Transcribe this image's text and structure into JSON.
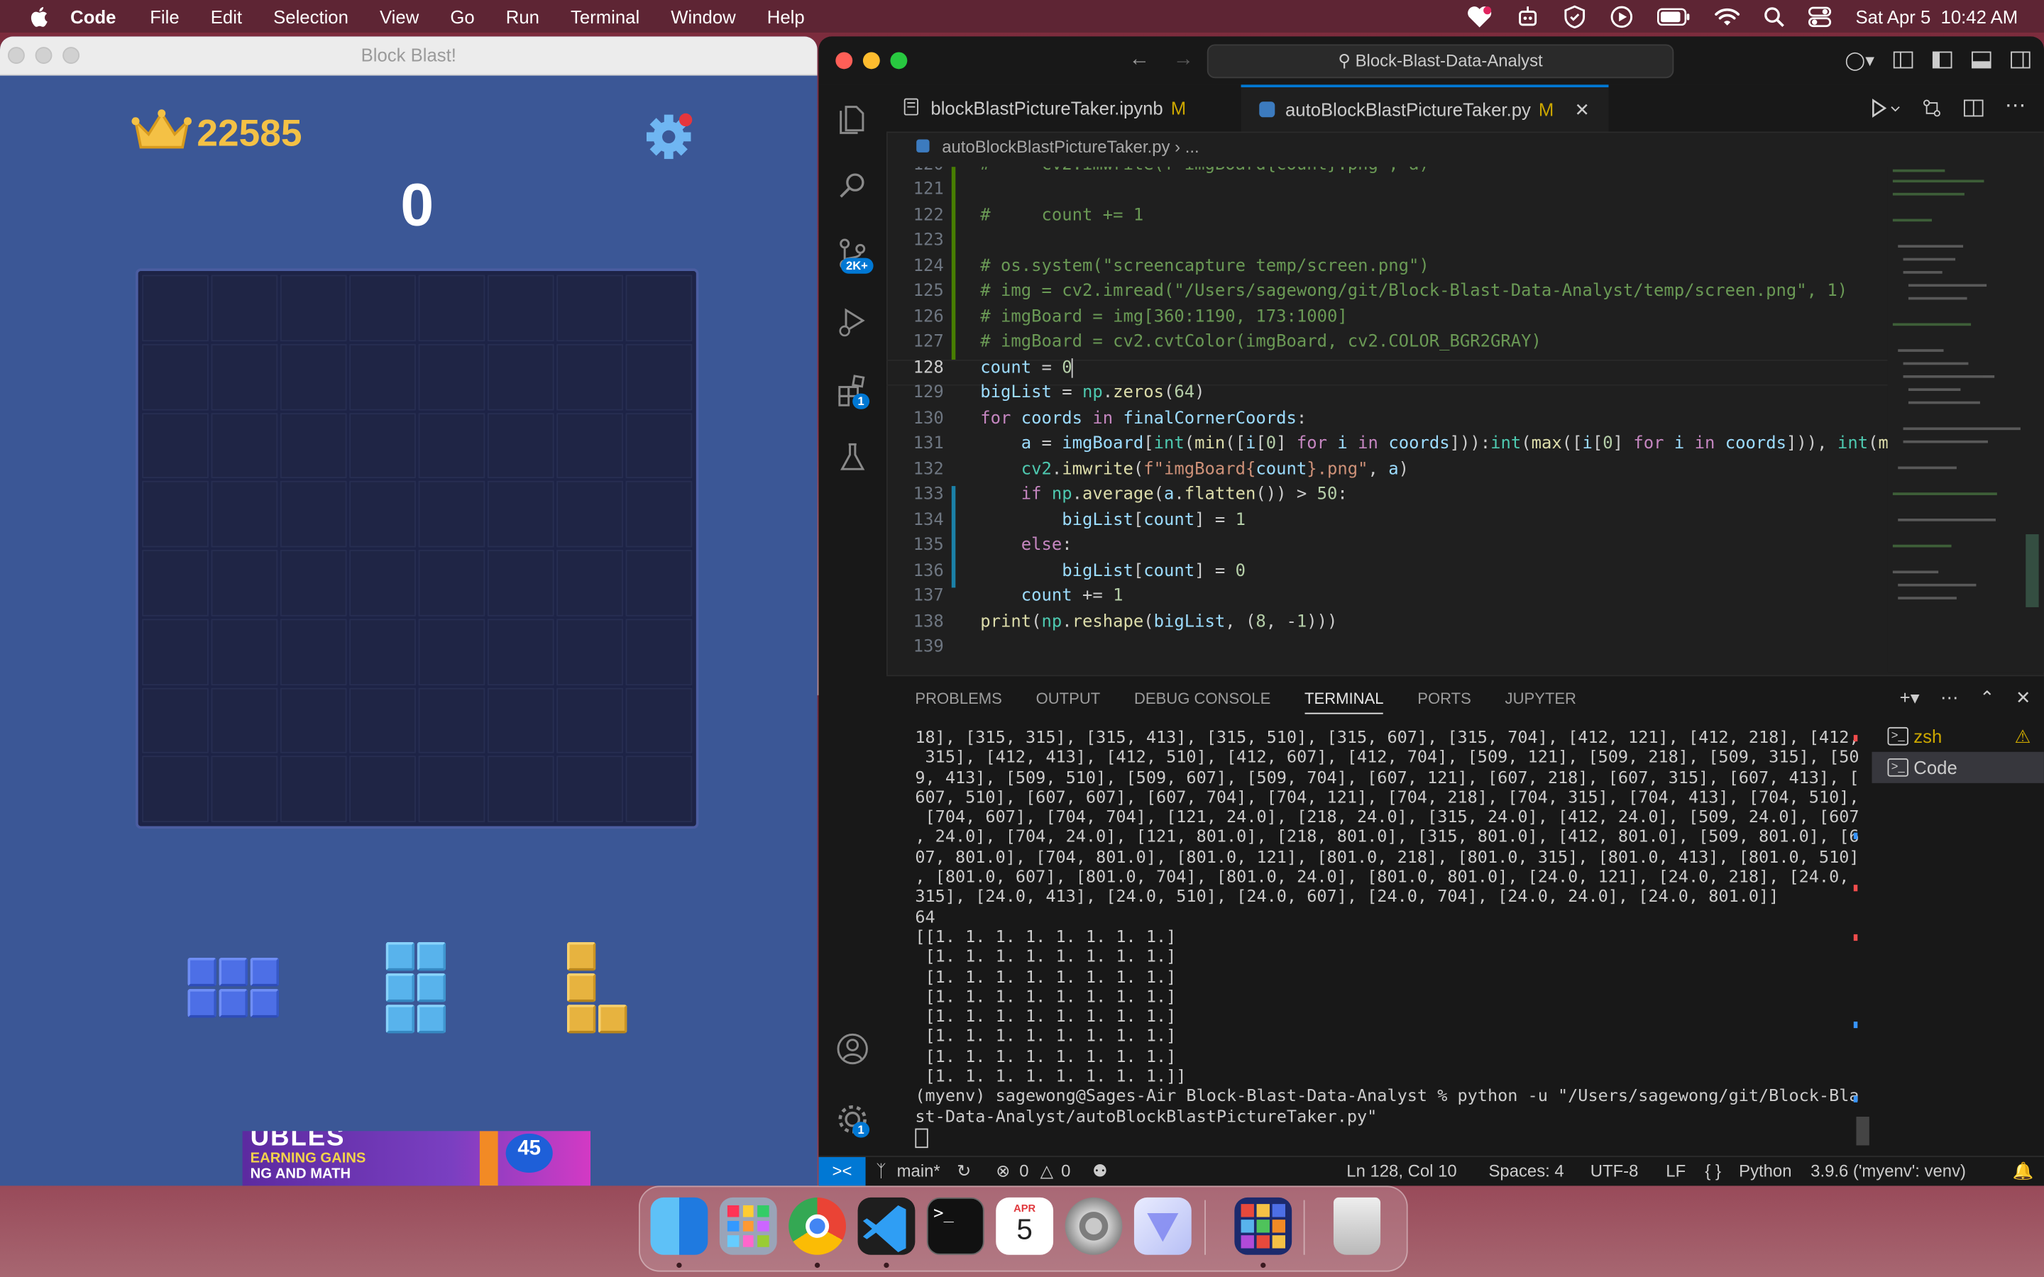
{
  "menubar": {
    "app": "Code",
    "items": [
      "File",
      "Edit",
      "Selection",
      "View",
      "Go",
      "Run",
      "Terminal",
      "Window",
      "Help"
    ],
    "datetime": "Sat Apr 5  10:42 AM"
  },
  "game": {
    "window_title": "Block Blast!",
    "best_score": "22585",
    "score": "0",
    "ad": {
      "line1": "UBLES",
      "line2": "EARNING GAINS",
      "line3": "NG AND MATH",
      "badge": "45"
    }
  },
  "vscode": {
    "command_center": "Block-Blast-Data-Analyst",
    "tabs": [
      {
        "label": "blockBlastPictureTaker.ipynb",
        "status": "M"
      },
      {
        "label": "autoBlockBlastPictureTaker.py",
        "status": "M"
      }
    ],
    "breadcrumb": "autoBlockBlastPictureTaker.py",
    "breadcrumb_more": "...",
    "badges": {
      "scm": "2K+",
      "extensions": "1",
      "settings": "1"
    },
    "panel_tabs": [
      "PROBLEMS",
      "OUTPUT",
      "DEBUG CONSOLE",
      "TERMINAL",
      "PORTS",
      "JUPYTER"
    ],
    "terminals": [
      "zsh",
      "Code"
    ],
    "terminal_output": "18], [315, 315], [315, 413], [315, 510], [315, 607], [315, 704], [412, 121], [412, 218], [412,\n 315], [412, 413], [412, 510], [412, 607], [412, 704], [509, 121], [509, 218], [509, 315], [50\n9, 413], [509, 510], [509, 607], [509, 704], [607, 121], [607, 218], [607, 315], [607, 413], [\n607, 510], [607, 607], [607, 704], [704, 121], [704, 218], [704, 315], [704, 413], [704, 510],\n [704, 607], [704, 704], [121, 24.0], [218, 24.0], [315, 24.0], [412, 24.0], [509, 24.0], [607\n, 24.0], [704, 24.0], [121, 801.0], [218, 801.0], [315, 801.0], [412, 801.0], [509, 801.0], [6\n07, 801.0], [704, 801.0], [801.0, 121], [801.0, 218], [801.0, 315], [801.0, 413], [801.0, 510]\n, [801.0, 607], [801.0, 704], [801.0, 24.0], [801.0, 801.0], [24.0, 121], [24.0, 218], [24.0,\n315], [24.0, 413], [24.0, 510], [24.0, 607], [24.0, 704], [24.0, 24.0], [24.0, 801.0]]\n64\n[[1. 1. 1. 1. 1. 1. 1. 1.]\n [1. 1. 1. 1. 1. 1. 1. 1.]\n [1. 1. 1. 1. 1. 1. 1. 1.]\n [1. 1. 1. 1. 1. 1. 1. 1.]\n [1. 1. 1. 1. 1. 1. 1. 1.]\n [1. 1. 1. 1. 1. 1. 1. 1.]\n [1. 1. 1. 1. 1. 1. 1. 1.]\n [1. 1. 1. 1. 1. 1. 1. 1.]]\n(myenv) sagewong@Sages-Air Block-Blast-Data-Analyst % python -u \"/Users/sagewong/git/Block-Bla\nst-Data-Analyst/autoBlockBlastPictureTaker.py\"",
    "status": {
      "branch": "main*",
      "errors": "0",
      "warnings": "0",
      "position": "Ln 128, Col 10",
      "spaces": "Spaces: 4",
      "encoding": "UTF-8",
      "eol": "LF",
      "language": "Python",
      "interpreter": "3.9.6 ('myenv': venv)"
    }
  },
  "dock": {
    "calendar_month": "APR",
    "calendar_day": "5"
  },
  "colors": {
    "accent": "#0078d4",
    "game_bg": "#3b5796",
    "gold": "#f4c145"
  }
}
